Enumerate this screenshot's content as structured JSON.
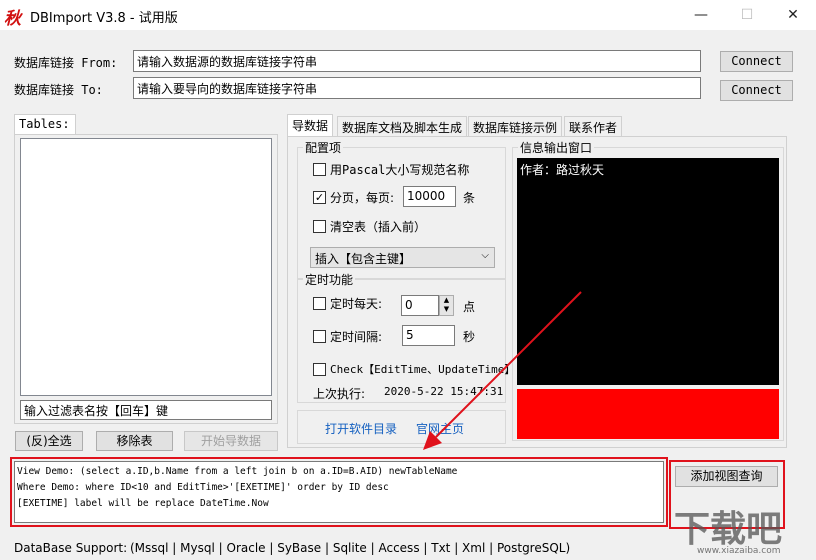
{
  "window": {
    "logo_char": "秋",
    "title": "DBImport V3.8 - 试用版",
    "minimize": "—",
    "maximize": "☐",
    "close": "✕"
  },
  "connection": {
    "from_label": "数据库链接 From:",
    "from_placeholder": "请输入数据源的数据库链接字符串",
    "to_label": "数据库链接 To:",
    "to_placeholder": "请输入要导向的数据库链接字符串",
    "connect_label": "Connect"
  },
  "tables": {
    "title": "Tables:",
    "filter_placeholder": "输入过滤表名按【回车】键",
    "select_all": "(反)全选",
    "remove": "移除表",
    "start_import": "开始导数据"
  },
  "tabs": [
    {
      "label": "导数据"
    },
    {
      "label": "数据库文档及脚本生成"
    },
    {
      "label": "数据库链接示例"
    },
    {
      "label": "联系作者"
    }
  ],
  "config": {
    "title": "配置项",
    "pascal_label": "用Pascal大小写规范名称",
    "paging_label": "分页，每页:",
    "paging_value": "10000",
    "paging_unit": "条",
    "clear_label": "清空表（插入前）",
    "insert_mode": "插入【包含主键】"
  },
  "timer": {
    "title": "定时功能",
    "daily_label": "定时每天:",
    "daily_value": "0",
    "daily_unit": "点",
    "interval_label": "定时间隔:",
    "interval_value": "5",
    "interval_unit": "秒",
    "check_label": "Check【EditTime、UpdateTime】",
    "last_run_label": "上次执行:",
    "last_run_value": "2020-5-22 15:47:31"
  },
  "links": {
    "open_dir": "打开软件目录",
    "homepage": "官网主页"
  },
  "info": {
    "title": "信息输出窗口",
    "output": "作者：路过秋天"
  },
  "view_query": {
    "lines": [
      "View  Demo: (select a.ID,b.Name from a left join b on a.ID=B.AID) newTableName",
      "Where Demo: where ID<10 and EditTime>'[EXETIME]' order by ID desc",
      "[EXETIME] label will be replace DateTime.Now"
    ],
    "add_button": "添加视图查询"
  },
  "status": {
    "label": "DataBase Support:",
    "items": "(Mssql | Mysql | Oracle | SyBase | Sqlite | Access | Txt | Xml | PostgreSQL)"
  },
  "watermark": {
    "brand": "下载吧",
    "url": "www.xiazaiba.com"
  },
  "colors": {
    "annotation_red": "#e0121c",
    "output_bg": "#000000",
    "progress_red": "#ff0000"
  }
}
